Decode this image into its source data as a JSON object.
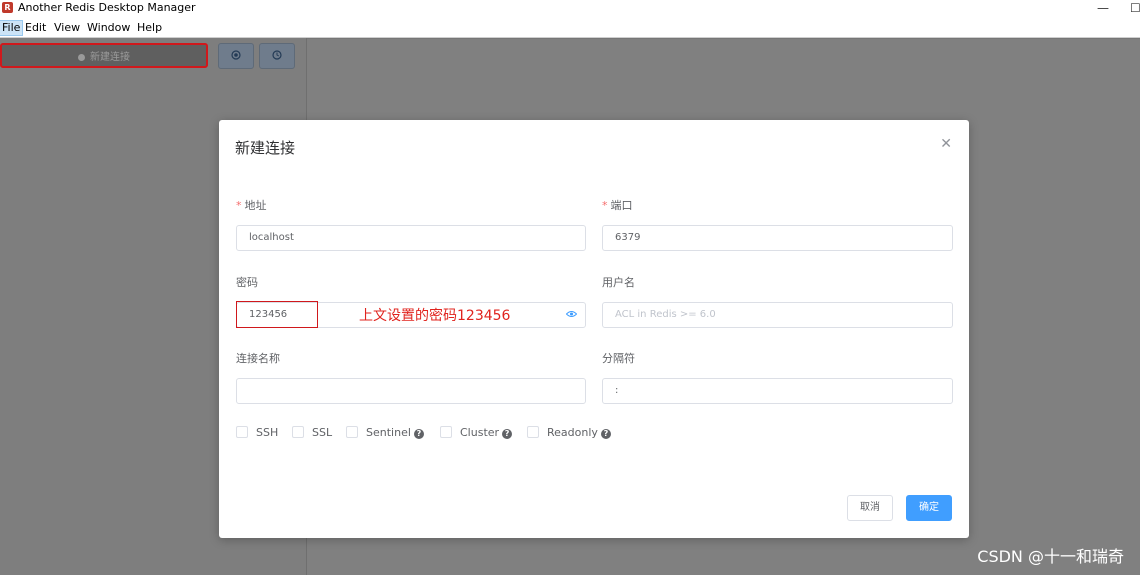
{
  "window": {
    "title": "Another Redis Desktop Manager",
    "minimize_glyph": "—",
    "maximize_glyph": "☐"
  },
  "menu": [
    "File",
    "Edit",
    "View",
    "Window",
    "Help"
  ],
  "sidebar": {
    "new_connection_label": "新建连接",
    "icon_buttons": [
      "target-icon",
      "clock-icon"
    ]
  },
  "dialog": {
    "title": "新建连接",
    "fields": {
      "host": {
        "label": "地址",
        "required": true,
        "value": "localhost"
      },
      "port": {
        "label": "端口",
        "required": true,
        "value": "6379"
      },
      "password": {
        "label": "密码",
        "value": "123456"
      },
      "username": {
        "label": "用户名",
        "placeholder": "ACL in Redis >= 6.0"
      },
      "connection_name": {
        "label": "连接名称",
        "value": ""
      },
      "separator": {
        "label": "分隔符",
        "value": ":"
      }
    },
    "checkboxes": [
      {
        "label": "SSH",
        "help": false
      },
      {
        "label": "SSL",
        "help": false
      },
      {
        "label": "Sentinel",
        "help": true
      },
      {
        "label": "Cluster",
        "help": true
      },
      {
        "label": "Readonly",
        "help": true
      }
    ],
    "cancel_label": "取消",
    "ok_label": "确定"
  },
  "annotation": "上文设置的密码123456",
  "watermark": "CSDN @十一和瑞奇",
  "colors": {
    "primary": "#409eff",
    "required": "#f56c6c",
    "highlight_red": "#d0181c",
    "overlay_gray": "#7f7f7f"
  }
}
